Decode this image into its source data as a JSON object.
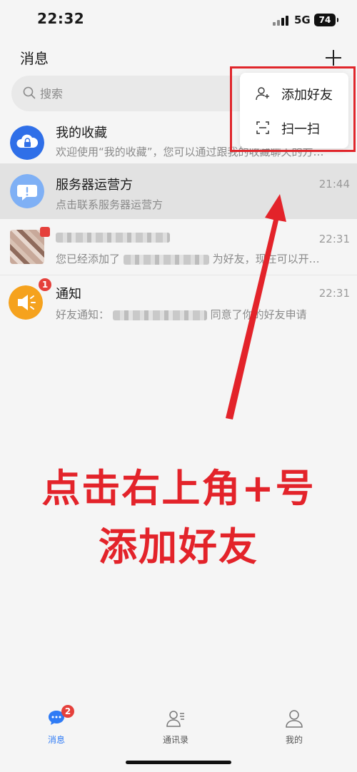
{
  "status_bar": {
    "time": "22:32",
    "network": "5G",
    "battery": "74"
  },
  "header": {
    "title": "消息"
  },
  "search": {
    "placeholder": "搜索"
  },
  "popup_menu": {
    "items": [
      {
        "label": "添加好友",
        "icon": "add-user-icon"
      },
      {
        "label": "扫一扫",
        "icon": "scan-icon"
      }
    ]
  },
  "conversations": [
    {
      "title": "我的收藏",
      "subtitle": "欢迎使用“我的收藏”，您可以通过跟我的收藏聊天的方…",
      "time": "",
      "avatar_color": "#2f6fe8",
      "icon": "cloud-lock-icon"
    },
    {
      "title": "服务器运营方",
      "subtitle": "点击联系服务器运营方",
      "time": "21:44",
      "avatar_color": "#7fb0f5",
      "icon": "chat-alert-icon"
    },
    {
      "title": "",
      "subtitle_prefix": "您已经添加了",
      "subtitle_suffix": "为好友，现在可以开…",
      "time": "22:31",
      "icon": "user-photo-avatar"
    },
    {
      "title": "通知",
      "subtitle_prefix": "好友通知：",
      "subtitle_suffix": "同意了你的好友申请",
      "time": "22:31",
      "badge": "1",
      "avatar_color": "#f5a21e",
      "icon": "speaker-icon"
    }
  ],
  "annotation": {
    "line1": "点击右上角+号",
    "line2": "添加好友",
    "color": "#e3232a"
  },
  "tabbar": {
    "tabs": [
      {
        "label": "消息",
        "badge": "2",
        "active": true
      },
      {
        "label": "通讯录",
        "active": false
      },
      {
        "label": "我的",
        "active": false
      }
    ],
    "accent": "#2f7bf5"
  }
}
